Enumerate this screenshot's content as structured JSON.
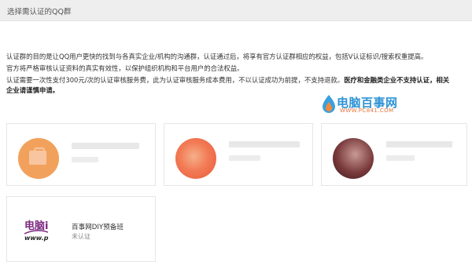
{
  "header": {
    "title": "选择需认证的QQ群"
  },
  "description": {
    "line1": "认证群的目的是让QQ用户更快的找到与各真实企业/机构的沟通群，认证通过后，将享有官方认证群相应的权益，包括V认证标识/搜索权重提高。",
    "line2": "官方将严格审核认证资料的真实有效性，以保护组织机构和平台用户的合法权益。",
    "line3_normal": "认证需要一次性支付300元/次的认证审核服务费，此为认证审核服务成本费用，不以认证成功为前提，不支持退款。",
    "line3_bold": "医疗和金融类企业不支持认证，相关",
    "line4_bold": "企业请谨慎申请。"
  },
  "watermark": {
    "title": "电脑百事网",
    "url": "WWW.PC841.COM"
  },
  "groups": [
    {
      "name": "",
      "status": "",
      "avatar_color": "#f0a050"
    },
    {
      "name": "",
      "status": "",
      "avatar_color": "#f07850"
    },
    {
      "name": "",
      "status": "",
      "avatar_color": "#8a3a3a"
    },
    {
      "name": "百事网DIY预备班",
      "status": "未认证",
      "logo_line1": "电脑i",
      "logo_line2": "www.p"
    }
  ],
  "colors": {
    "header_bg": "#eeeeee",
    "watermark_blue": "#2e93d6",
    "watermark_orange": "#e8743a",
    "logo_purple": "#7d2a82"
  }
}
